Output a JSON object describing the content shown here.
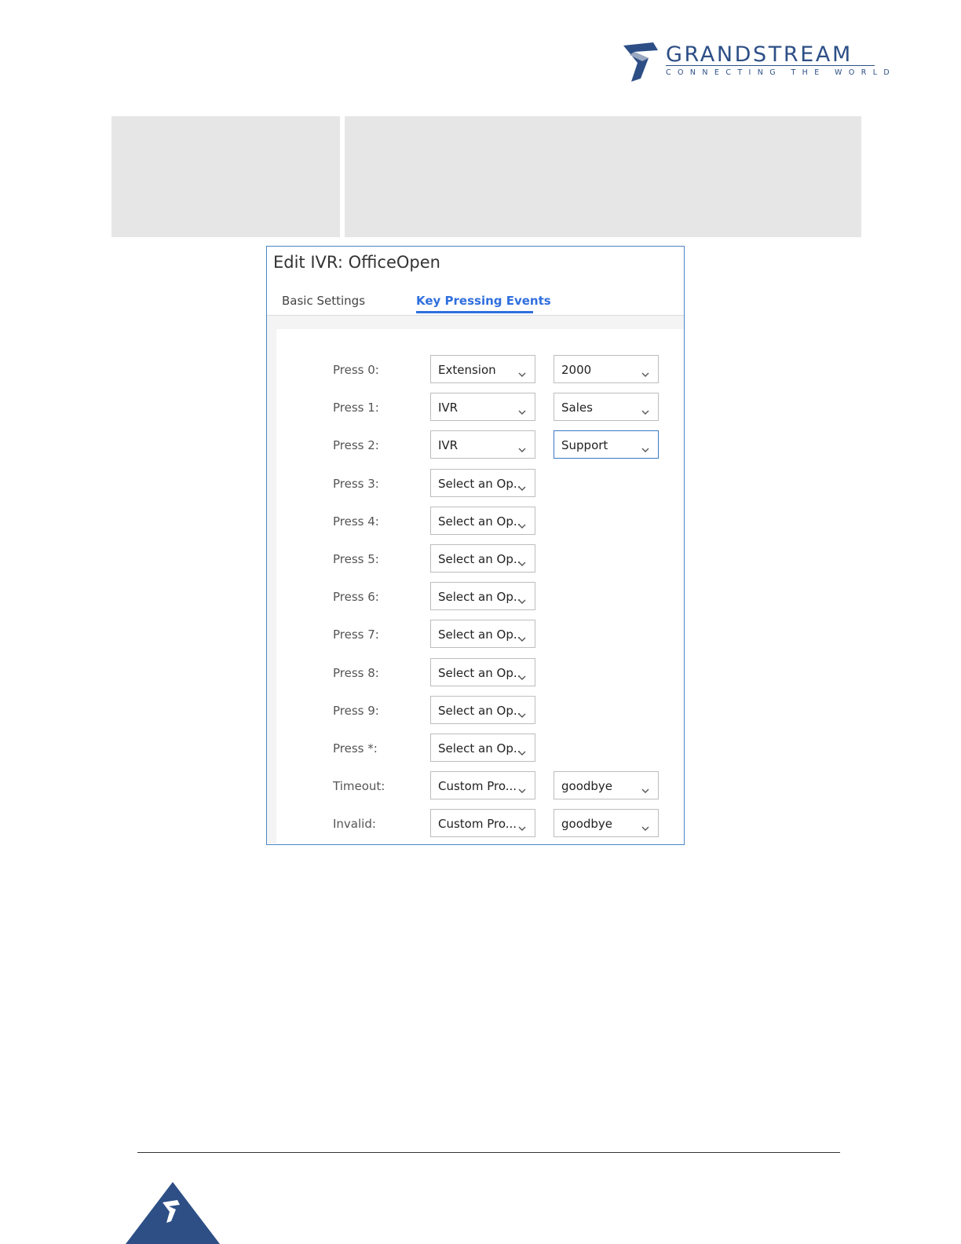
{
  "header": {
    "brand_name": "GRANDSTREAM",
    "brand_tagline": "CONNECTING THE WORLD",
    "brand_color": "#2d4f86"
  },
  "dialog": {
    "title": "Edit IVR: OfficeOpen",
    "tabs": [
      {
        "label": "Basic Settings",
        "active": false
      },
      {
        "label": "Key Pressing Events",
        "active": true
      }
    ],
    "rows": [
      {
        "label": "Press 0:",
        "type": "Extension",
        "target": "2000"
      },
      {
        "label": "Press 1:",
        "type": "IVR",
        "target": "Sales"
      },
      {
        "label": "Press 2:",
        "type": "IVR",
        "target": "Support"
      },
      {
        "label": "Press 3:",
        "type": "Select an Op..."
      },
      {
        "label": "Press 4:",
        "type": "Select an Op..."
      },
      {
        "label": "Press 5:",
        "type": "Select an Op..."
      },
      {
        "label": "Press 6:",
        "type": "Select an Op..."
      },
      {
        "label": "Press 7:",
        "type": "Select an Op..."
      },
      {
        "label": "Press 8:",
        "type": "Select an Op..."
      },
      {
        "label": "Press 9:",
        "type": "Select an Op..."
      },
      {
        "label": "Press *:",
        "type": "Select an Op..."
      },
      {
        "label": "Timeout:",
        "type": "Custom Pro...",
        "target": "goodbye"
      },
      {
        "label": "Invalid:",
        "type": "Custom Pro...",
        "target": "goodbye"
      }
    ],
    "accent_color": "#2f6fde",
    "border_color": "#4a86c5"
  }
}
